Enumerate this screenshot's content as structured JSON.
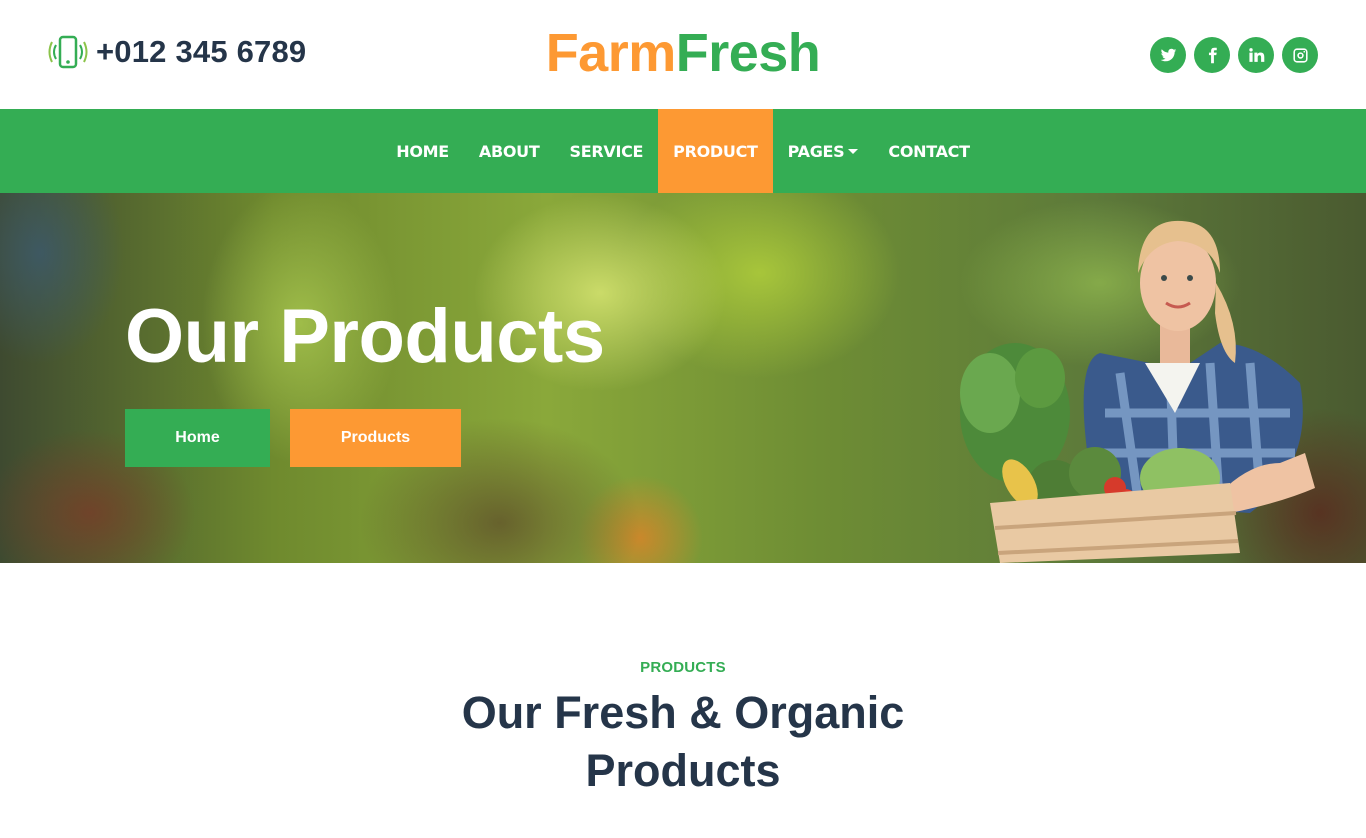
{
  "header": {
    "phone_icon": "mobile-vibrate-icon",
    "phone_number": "+012 345 6789",
    "logo_part1": "Farm",
    "logo_part2": "Fresh",
    "social": [
      {
        "name": "twitter",
        "icon": "twitter-icon"
      },
      {
        "name": "facebook",
        "icon": "facebook-icon"
      },
      {
        "name": "linkedin",
        "icon": "linkedin-icon"
      },
      {
        "name": "instagram",
        "icon": "instagram-icon"
      }
    ]
  },
  "nav": {
    "items": [
      {
        "label": "HOME"
      },
      {
        "label": "ABOUT"
      },
      {
        "label": "SERVICE"
      },
      {
        "label": "PRODUCT",
        "active": true
      },
      {
        "label": "PAGES",
        "dropdown": true
      },
      {
        "label": "CONTACT"
      }
    ]
  },
  "hero": {
    "title": "Our Products",
    "breadcrumb_home": "Home",
    "breadcrumb_current": "Products"
  },
  "section": {
    "eyebrow": "PRODUCTS",
    "title": "Our Fresh & Organic Products"
  },
  "colors": {
    "primary_green": "#34ad54",
    "accent_orange": "#fd9933",
    "heading_dark": "#253549"
  }
}
